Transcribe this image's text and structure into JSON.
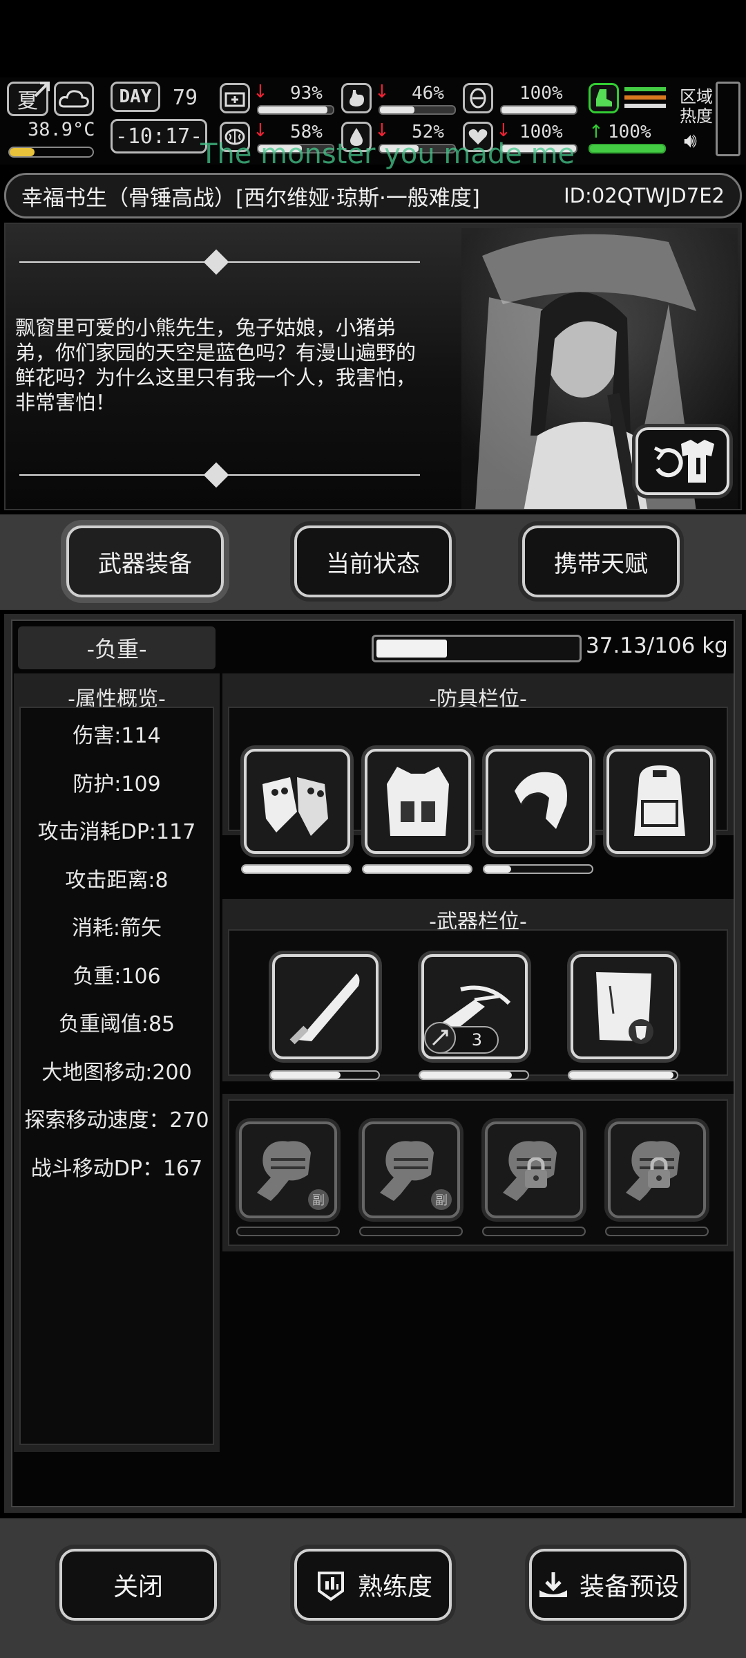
{
  "hud": {
    "season": "夏",
    "temperature": "38.9°C",
    "day_label": "DAY",
    "day_number": "79",
    "time": "-10:17-",
    "overlay_song": "The monster you made me",
    "zone_heat_label": "区域\n热度",
    "stats": {
      "health_pct": "93%",
      "stomach_pct": "46%",
      "stamina_pct": "100%",
      "brain_pct": "58%",
      "water_pct": "52%",
      "heart_pct": "100%",
      "move_pct": "100%"
    },
    "values": {
      "health": 0.93,
      "stomach": 0.46,
      "stamina": 1.0,
      "brain": 0.58,
      "water": 0.52,
      "heart": 1.0,
      "move": 1.0
    }
  },
  "title_bar": {
    "name": "幸福书生（骨锤高战）[西尔维娅·琼斯·一般难度]",
    "id": "ID:02QTWJD7E2"
  },
  "dialog": {
    "text": "飘窗里可爱的小熊先生，兔子姑娘，小猪弟弟，你们家园的天空是蓝色吗？有漫山遍野的鲜花吗？为什么这里只有我一个人，我害怕，非常害怕！"
  },
  "tabs": [
    "武器装备",
    "当前状态",
    "携带天赋"
  ],
  "load": {
    "label": "-负重-",
    "value_text": "37.13/106 kg",
    "fraction": 0.35
  },
  "attributes": {
    "title": "-属性概览-",
    "items": [
      "伤害:114",
      "防护:109",
      "攻击消耗DP:117",
      "攻击距离:8",
      "消耗:箭矢",
      "负重:106",
      "负重阈值:85",
      "大地图移动:200",
      "探索移动速度：270",
      "战斗移动DP：167"
    ]
  },
  "armor": {
    "title": "-防具栏位-",
    "slots": [
      {
        "icon": "gloves-icon",
        "durability": 1.0
      },
      {
        "icon": "vest-icon",
        "durability": 1.0
      },
      {
        "icon": "helmet-icon",
        "durability": 0.25
      },
      {
        "icon": "backpack-icon",
        "durability": null
      }
    ]
  },
  "weapons": {
    "title": "-武器栏位-",
    "slots": [
      {
        "icon": "machete-icon",
        "durability": 0.65
      },
      {
        "icon": "crossbow-icon",
        "durability": 0.85,
        "ammo": "3"
      },
      {
        "icon": "shield-board-icon",
        "durability": 0.97
      }
    ]
  },
  "sub_slots": [
    {
      "icon": "fist-icon",
      "badge": "副",
      "locked": false
    },
    {
      "icon": "fist-icon",
      "badge": "副",
      "locked": false
    },
    {
      "icon": "fist-icon",
      "locked": true
    },
    {
      "icon": "fist-icon",
      "locked": true
    }
  ],
  "bottom": {
    "close": "关闭",
    "proficiency": "熟练度",
    "preset": "装备预设"
  }
}
